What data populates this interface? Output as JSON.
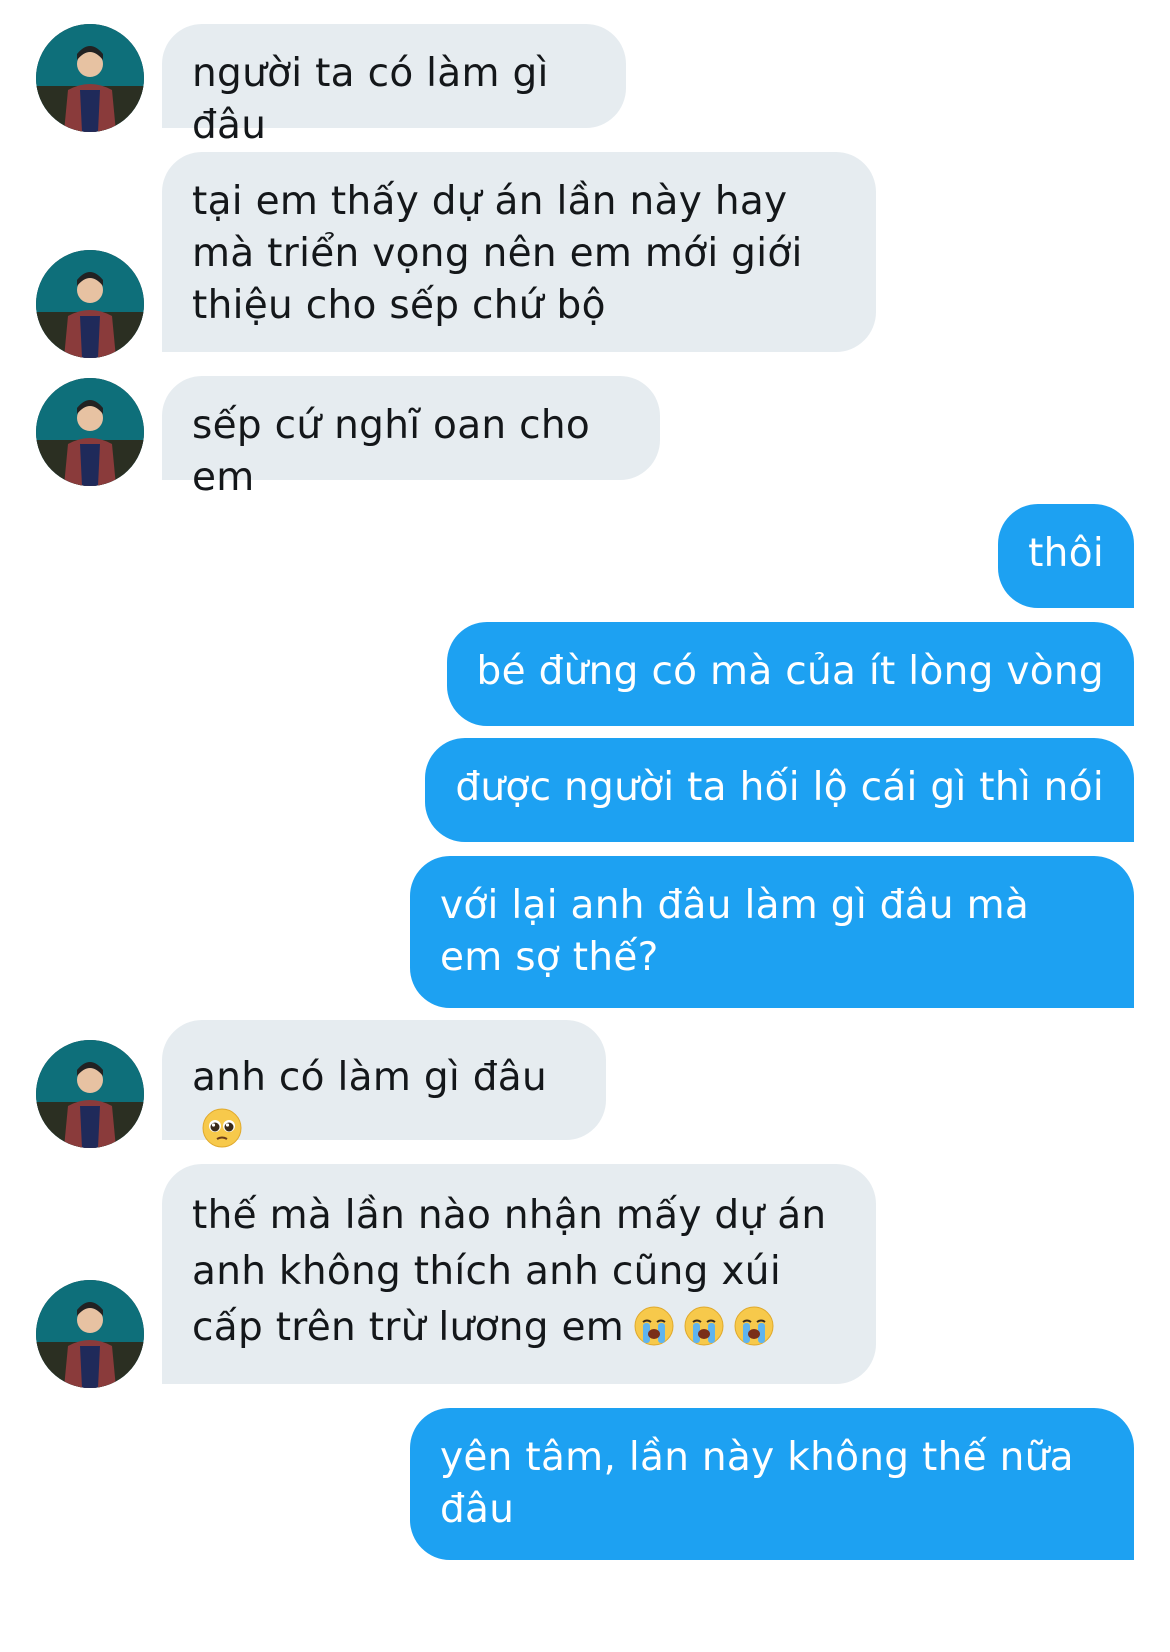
{
  "conversation": {
    "messages": [
      {
        "sender": "them",
        "text": "người ta có làm gì đâu"
      },
      {
        "sender": "them",
        "text": "tại em thấy dự án lần này hay mà triển vọng nên em mới giới thiệu cho sếp chứ bộ"
      },
      {
        "sender": "them",
        "text": "sếp cứ nghĩ oan cho em"
      },
      {
        "sender": "me",
        "text": "thôi"
      },
      {
        "sender": "me",
        "text": "bé đừng có mà của ít lòng vòng"
      },
      {
        "sender": "me",
        "text": "được người ta hối lộ cái gì thì nói"
      },
      {
        "sender": "me",
        "text": "với lại anh đâu làm gì đâu mà em sợ thế?"
      },
      {
        "sender": "them",
        "text": "anh có làm gì đâu",
        "emoji": [
          "pleading-face-icon"
        ]
      },
      {
        "sender": "them",
        "text": "thế mà lần nào nhận mấy dự án anh không thích anh cũng xúi cấp trên trừ lương em",
        "emoji": [
          "loudly-crying-face-icon",
          "loudly-crying-face-icon",
          "loudly-crying-face-icon"
        ]
      },
      {
        "sender": "me",
        "text": "yên tâm, lần này không thế nữa đâu"
      }
    ]
  },
  "colors": {
    "incoming_bubble": "#e6ecf0",
    "outgoing_bubble": "#1da1f2",
    "incoming_text": "#14171a",
    "outgoing_text": "#ffffff"
  }
}
